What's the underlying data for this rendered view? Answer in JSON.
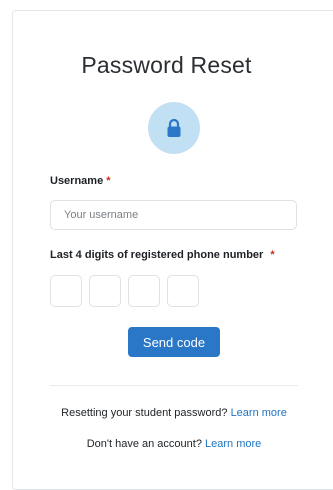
{
  "page": {
    "title": "Password Reset",
    "lock_icon": "lock-icon"
  },
  "form": {
    "username_label": "Username",
    "username_placeholder": "Your username",
    "username_value": "",
    "phone_label": "Last 4 digits of registered phone number",
    "required_marker": "*",
    "phone_digits": [
      "",
      "",
      "",
      ""
    ],
    "send_button": "Send code"
  },
  "footer": {
    "student_text": "Resetting your student password?",
    "student_link": "Learn more",
    "account_text": "Don't have an account?",
    "account_link": "Learn more"
  },
  "colors": {
    "primary": "#2a76c7",
    "link": "#1f74c3",
    "icon_bg": "#c2e0f4",
    "required": "#ca3120"
  }
}
